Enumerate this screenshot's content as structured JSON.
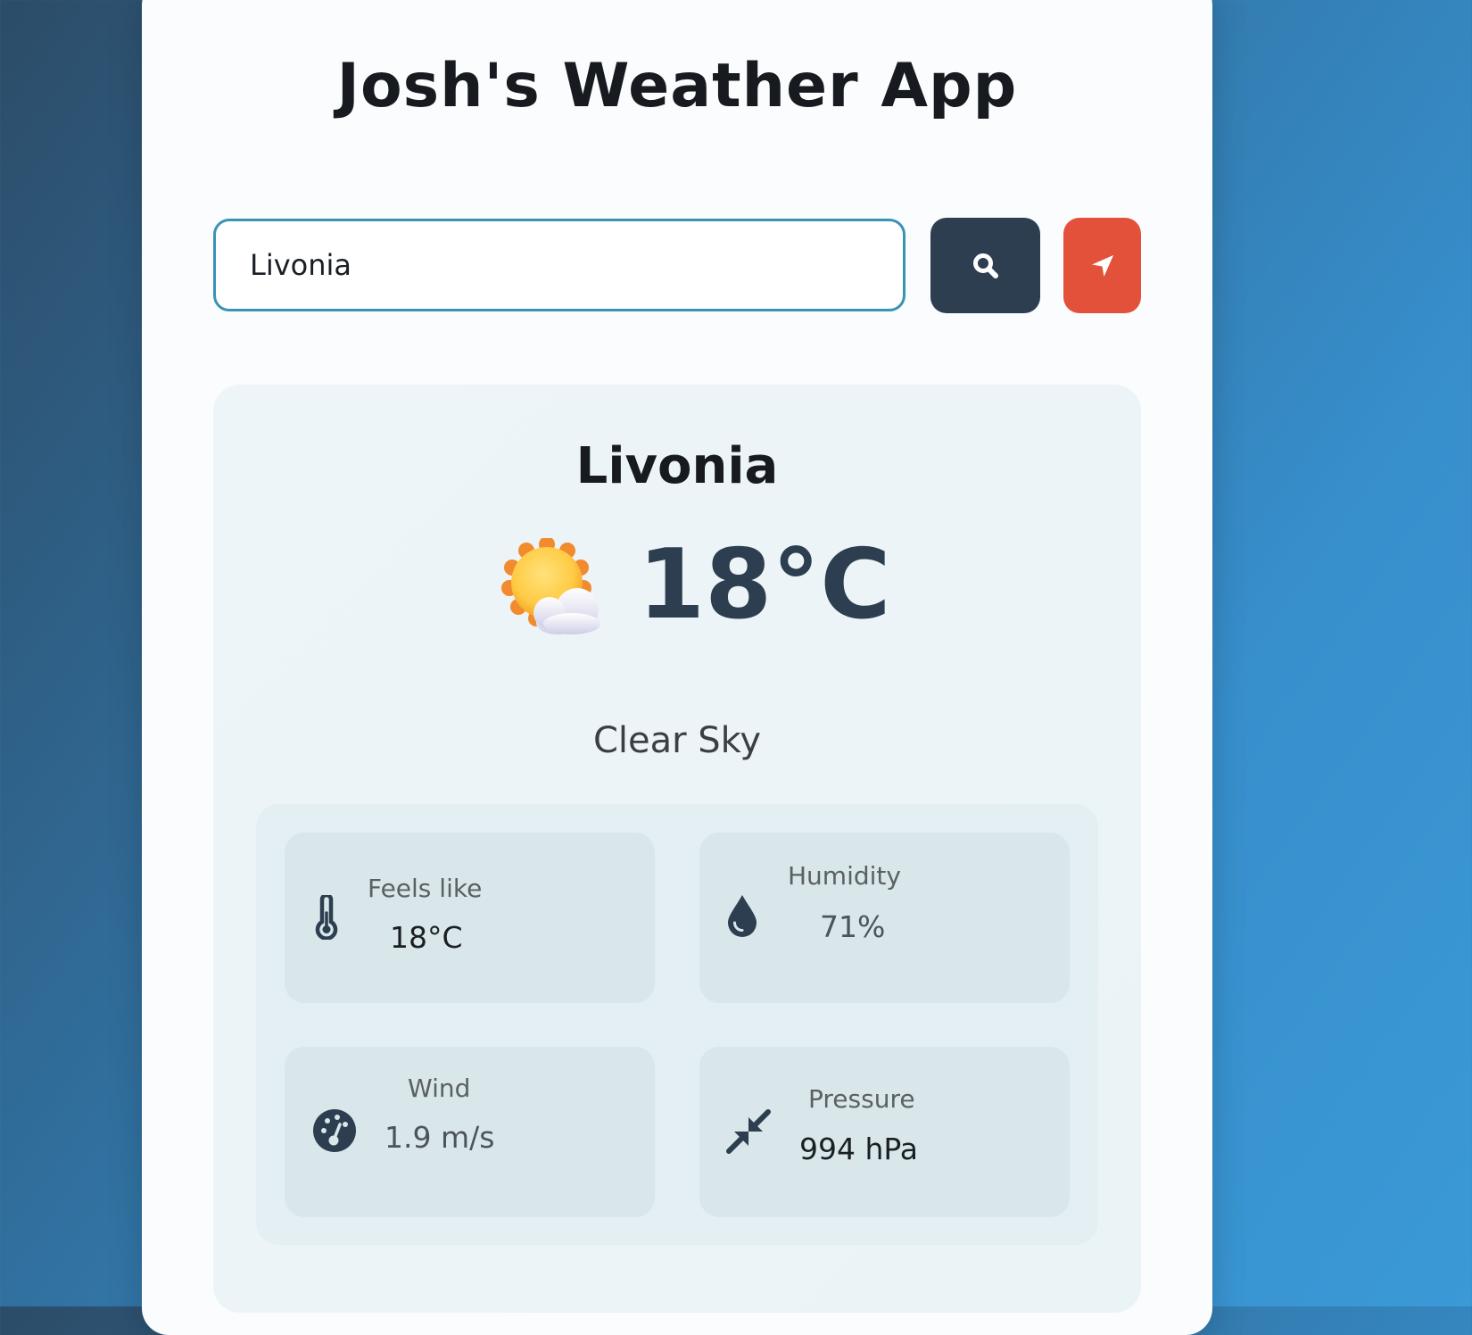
{
  "app": {
    "title": "Josh's Weather App"
  },
  "search": {
    "value": "Livonia",
    "placeholder": ""
  },
  "buttons": {
    "search_icon": "search-icon",
    "location_icon": "location-arrow-icon"
  },
  "weather": {
    "city": "Livonia",
    "temperature": "18°C",
    "description": "Clear Sky",
    "icon": "sun-behind-cloud-icon"
  },
  "details": {
    "feels_like": {
      "label": "Feels like",
      "value": "18°C",
      "icon": "thermometer-icon"
    },
    "humidity": {
      "label": "Humidity",
      "value": "71%",
      "icon": "water-drop-icon"
    },
    "wind": {
      "label": "Wind",
      "value": "1.9 m/s",
      "icon": "gauge-icon"
    },
    "pressure": {
      "label": "Pressure",
      "value": "994 hPa",
      "icon": "compress-arrows-icon"
    }
  },
  "colors": {
    "primary": "#2c3e50",
    "accent": "#e4513b",
    "input_border": "#3a93b5",
    "background_start": "#2c4c68",
    "background_end": "#3b99d6"
  }
}
